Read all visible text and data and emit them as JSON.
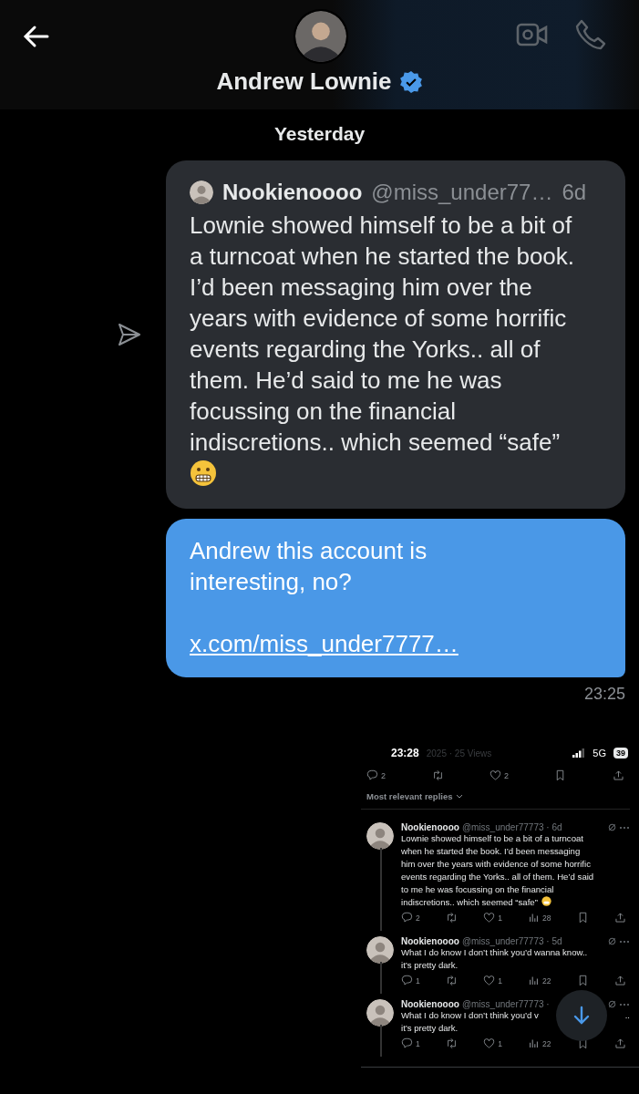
{
  "header": {
    "name": "Andrew Lownie",
    "verified": true
  },
  "date_divider": "Yesterday",
  "messages": [
    {
      "kind": "quote",
      "quote": {
        "author": "Nookienoooo",
        "handle": "@miss_under77…",
        "age": "6d",
        "text": "Lownie showed himself to be a bit of a turncoat when he started the book. I’d been messaging him over the years with evidence of some horrific events regarding the Yorks.. all of them. He’d said to me he was focussing on the financial indiscretions.. which seemed “safe”"
      }
    },
    {
      "kind": "text",
      "text": "Andrew this account is interesting, no?",
      "link": "x.com/miss_under7777…",
      "time": "23:25"
    }
  ],
  "attachment": {
    "status_bar": {
      "time": "23:28",
      "network": "5G",
      "battery": "39"
    },
    "post_meta": "2025 · 25 Views",
    "post_actions": {
      "replies": "2",
      "likes": "2"
    },
    "sort_label": "Most relevant replies",
    "replies": [
      {
        "author": "Nookienoooo",
        "handle": "@miss_under77773 · 6d",
        "lines": [
          [
            "Lownie showed himself to be a bit of a turncoat"
          ],
          [
            "when he started the book. I’d been messaging"
          ],
          [
            "him over the years with evidence of some horrific"
          ],
          [
            "events regarding the Yorks.. all of them. He’d said"
          ],
          [
            "to me he was focussing on the financial"
          ],
          [
            "indiscretions.. which seemed “safe”"
          ]
        ],
        "replies": "2",
        "likes": "1",
        "views": "28"
      },
      {
        "author": "Nookienoooo",
        "handle": "@miss_under77773 · 5d",
        "lines": [
          [
            "What I do know I don’t think you’d wanna know.."
          ],
          [
            "it’s pretty dark."
          ]
        ],
        "replies": "1",
        "likes": "1",
        "views": "22"
      },
      {
        "author": "Nookienoooo",
        "handle": "@miss_under77773 ·",
        "lines": [
          [
            "What I do know I don’t think you’d v",
            ".."
          ],
          [
            "it’s pretty dark."
          ]
        ],
        "replies": "1",
        "likes": "1",
        "views": "22"
      }
    ]
  }
}
